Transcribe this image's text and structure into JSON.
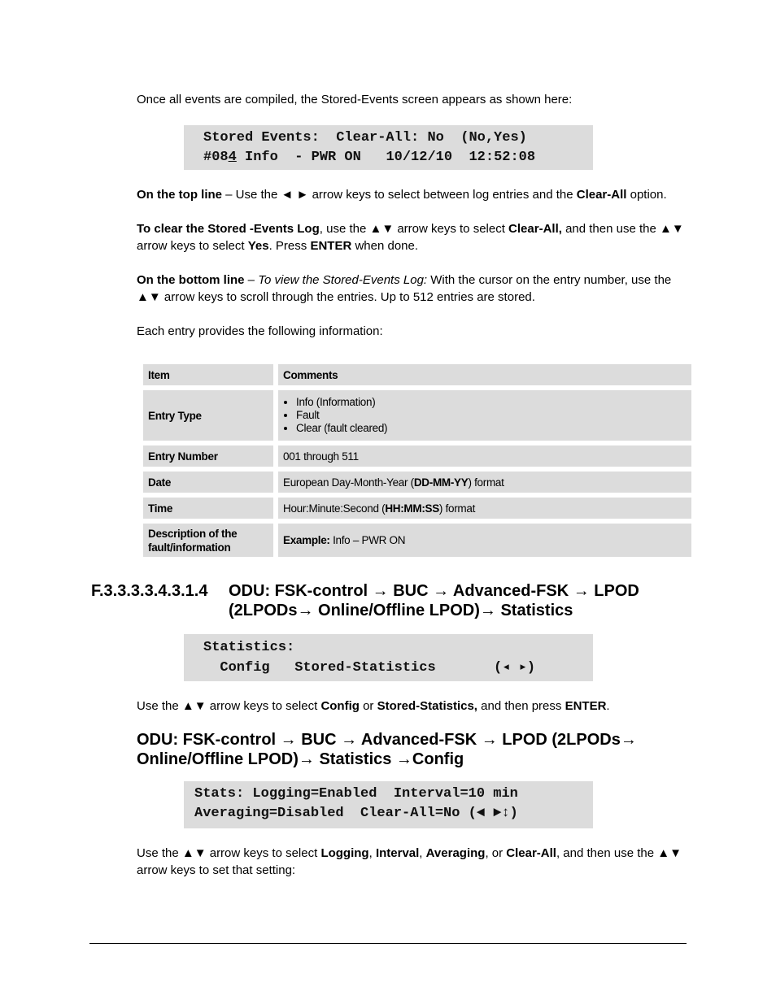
{
  "intro": "Once all events are compiled, the Stored-Events screen appears as shown here:",
  "lcd1": {
    "line1": "Stored Events:  Clear-All: No  (No,Yes)",
    "line2_prefix": "#08",
    "line2_cursor": "4",
    "line2_rest": " Info  - PWR ON   10/12/10  12:52:08"
  },
  "para_top": {
    "b1": "On the top line",
    "t1": " – Use the ◄ ► arrow keys to select between log entries and the ",
    "b2": "Clear-All",
    "t2": " option."
  },
  "para_clear": {
    "b1": "To clear the Stored -Events Log",
    "t1": ", use the ▲▼ arrow keys to select ",
    "b2": "Clear-All,",
    "t2": " and then use the ▲▼ arrow keys to select ",
    "b3": "Yes",
    "t3": ". Press ",
    "b4": "ENTER",
    "t4": " when done."
  },
  "para_bottom": {
    "b1": "On the bottom line",
    "t1": " – ",
    "i1": "To view the Stored-Events Log:",
    "t2": " With the cursor on the entry number, use the ▲▼ arrow keys to scroll through the entries. Up to 512 entries are stored."
  },
  "para_each": "Each entry provides the following information:",
  "table": {
    "headers": [
      "Item",
      "Comments"
    ],
    "entry_type": {
      "item": "Entry Type",
      "bullets": [
        "Info (Information)",
        "Fault",
        "Clear (fault cleared)"
      ]
    },
    "entry_number": {
      "item": "Entry Number",
      "comment": "001 through 511"
    },
    "date": {
      "item": "Date",
      "pre": "European Day-Month-Year (",
      "bold": "DD-MM-YY",
      "post": ") format"
    },
    "time": {
      "item": "Time",
      "pre": "Hour:Minute:Second (",
      "bold": "HH:MM:SS",
      "post": ") format"
    },
    "desc": {
      "item": "Description of the fault/information",
      "bold": "Example:",
      "post": " Info – PWR ON"
    }
  },
  "section": {
    "number": "F.3.3.3.3.4.3.1.4",
    "title_line1": "ODU: FSK-control → BUC → Advanced-FSK → LPOD",
    "title_line2": "(2LPODs→ Online/Offline LPOD)→ Statistics"
  },
  "lcd2": {
    "line1": "Statistics:",
    "line2": "  Config   Stored-Statistics       (◂ ▸)"
  },
  "para_stats": {
    "t1": "Use the ▲▼ arrow keys to select ",
    "b1": "Config",
    "t2": " or ",
    "b2": "Stored-Statistics,",
    "t3": " and then press ",
    "b3": "ENTER",
    "t4": "."
  },
  "subheading": {
    "line1": "ODU: FSK-control → BUC → Advanced-FSK → LPOD (2LPODs→",
    "line2": "Online/Offline LPOD)→ Statistics →Config"
  },
  "lcd3": {
    "line1": "Stats: Logging=Enabled  Interval=10 min",
    "line2": "Averaging=Disabled  Clear-All=No (◄ ►↕)"
  },
  "para_config": {
    "t1": "Use the ▲▼ arrow keys to select ",
    "b1": "Logging",
    "t2": ", ",
    "b2": "Interval",
    "t3": ", ",
    "b3": "Averaging",
    "t4": ", or ",
    "b4": "Clear-All",
    "t5": ", and then use the ▲▼ arrow keys to set that setting:"
  }
}
